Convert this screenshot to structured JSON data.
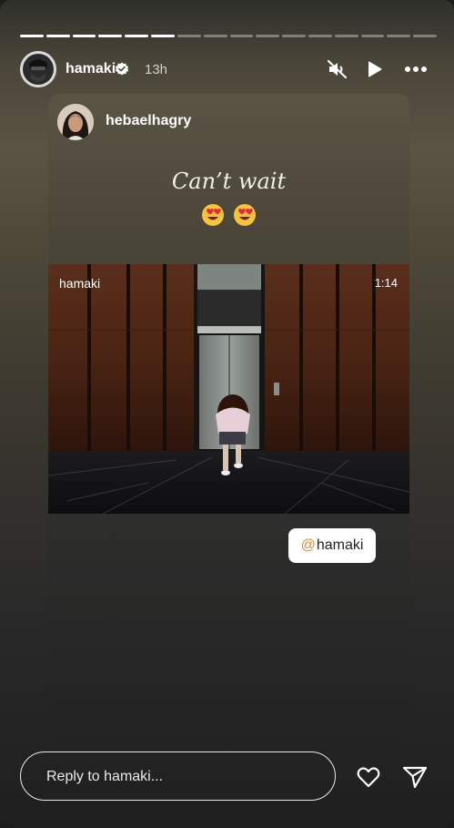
{
  "story": {
    "progress": {
      "total": 16,
      "completed": 6
    },
    "header": {
      "username": "hamaki",
      "verified": true,
      "time": "13h",
      "icons": [
        "muted-speaker-icon",
        "play-icon",
        "more-options-icon"
      ]
    },
    "card": {
      "username": "hebaelhagry",
      "caption": "Can’t wait",
      "emoji": "😍😍",
      "video": {
        "username": "hamaki",
        "duration": "1:14"
      },
      "mention": {
        "at": "@",
        "name": "hamaki"
      }
    },
    "footer": {
      "reply_placeholder": "Reply to hamaki...",
      "icons": [
        "heart-icon",
        "send-icon"
      ]
    },
    "colors": {
      "verified": "#ffffff",
      "mention_at": "#e08a2f"
    }
  }
}
